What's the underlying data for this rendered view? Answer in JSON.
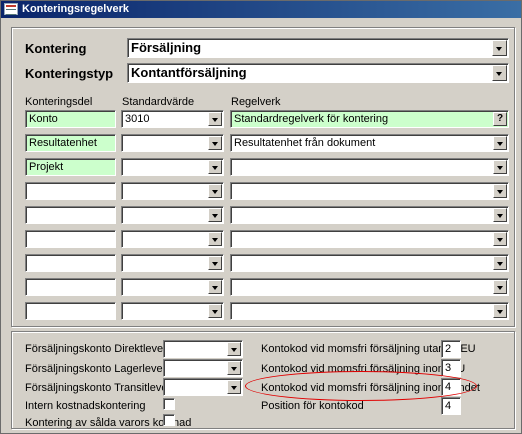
{
  "window": {
    "title": "Konteringsregelverk"
  },
  "header": {
    "kontering_label": "Kontering",
    "kontering_value": "Försäljning",
    "konteringstyp_label": "Konteringstyp",
    "konteringstyp_value": "Kontantförsäljning"
  },
  "columns": {
    "konteringsdel": "Konteringsdel",
    "standardvarde": "Standardvärde",
    "regelverk": "Regelverk"
  },
  "rows": [
    {
      "del": "Konto",
      "standard": "3010",
      "regelverk": "Standardregelverk för kontering",
      "help": "?"
    },
    {
      "del": "Resultatenhet",
      "standard": "",
      "regelverk": "Resultatenhet från dokument"
    },
    {
      "del": "Projekt",
      "standard": "",
      "regelverk": ""
    },
    {
      "del": "",
      "standard": "",
      "regelverk": ""
    },
    {
      "del": "",
      "standard": "",
      "regelverk": ""
    },
    {
      "del": "",
      "standard": "",
      "regelverk": ""
    },
    {
      "del": "",
      "standard": "",
      "regelverk": ""
    },
    {
      "del": "",
      "standard": "",
      "regelverk": ""
    }
  ],
  "bottom_left": [
    {
      "label": "Försäljningskonto Direktleverans",
      "value": ""
    },
    {
      "label": "Försäljningskonto Lagerleverans",
      "value": ""
    },
    {
      "label": "Försäljningskonto Transitleverans",
      "value": ""
    }
  ],
  "checkboxes": [
    {
      "label": "Intern kostnadskontering",
      "checked": false
    },
    {
      "label": "Kontering av sålda varors kostnad",
      "checked": false
    }
  ],
  "bottom_right": [
    {
      "label": "Kontokod vid momsfri försäljning utanför EU",
      "value": "2"
    },
    {
      "label": "Kontokod vid momsfri försäljning inom EU",
      "value": "3"
    },
    {
      "label": "Kontokod vid momsfri försäljning inom landet",
      "value": "4"
    },
    {
      "label": "Position för kontokod",
      "value": "4"
    }
  ],
  "colors": {
    "highlight_field": "#ccffcc",
    "annotation": "#e00000",
    "titlebar": "#0a246a"
  }
}
